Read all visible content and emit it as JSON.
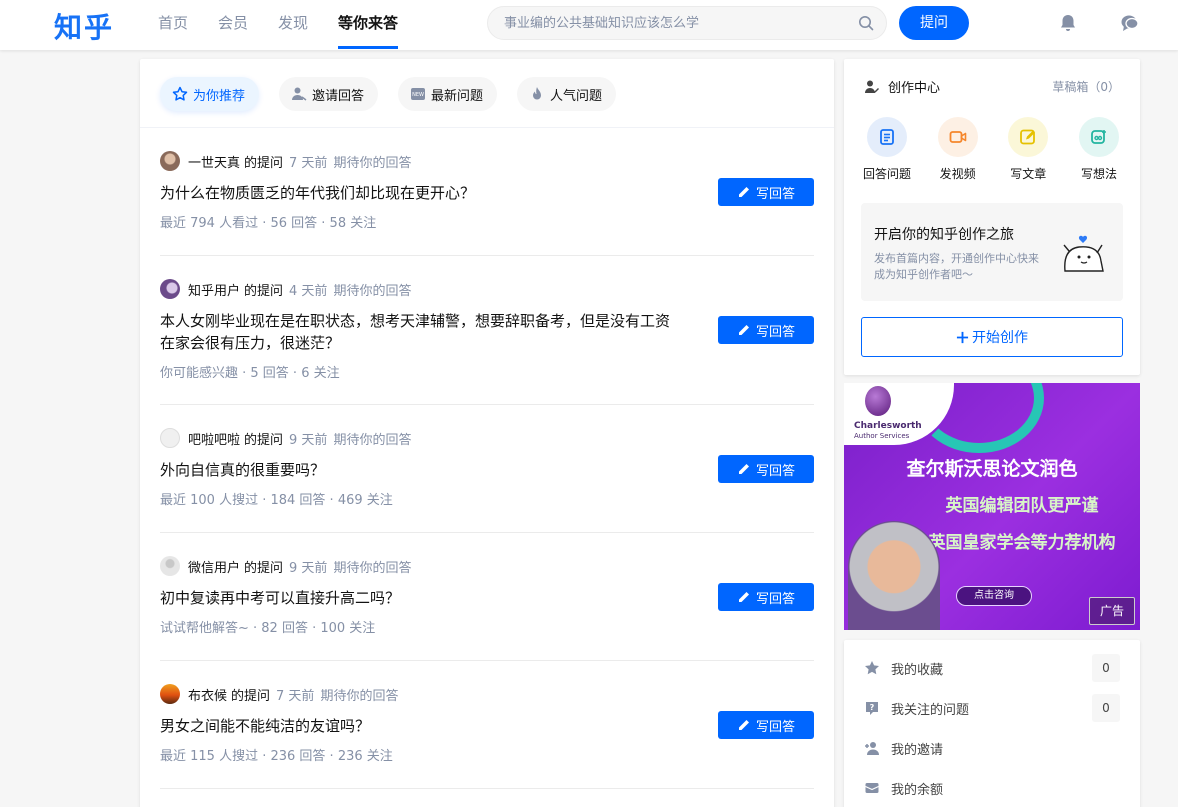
{
  "header": {
    "logo": "知乎",
    "nav": [
      "首页",
      "会员",
      "发现",
      "等你来答"
    ],
    "active_nav": "等你来答",
    "search_placeholder": "事业编的公共基础知识应该怎么学",
    "ask_label": "提问",
    "accent": "#0066ff"
  },
  "tabs": [
    {
      "label": "为你推荐",
      "icon": "star-icon"
    },
    {
      "label": "邀请回答",
      "icon": "invite-user-icon"
    },
    {
      "label": "最新问题",
      "icon": "new-badge-icon"
    },
    {
      "label": "人气问题",
      "icon": "flame-icon"
    }
  ],
  "questions": [
    {
      "author": "一世天真",
      "asked": "的提问",
      "time": "7 天前",
      "hint": "期待你的回答",
      "title": "为什么在物质匮乏的年代我们却比现在更开心？",
      "stats": "最近 794 人看过 · 56 回答 · 58 关注",
      "button": "写回答"
    },
    {
      "author": "知乎用户",
      "asked": "的提问",
      "time": "4 天前",
      "hint": "期待你的回答",
      "title": "本人女刚毕业现在是在职状态，想考天津辅警，想要辞职备考，但是没有工资在家会很有压力，很迷茫？",
      "stats": "你可能感兴趣 · 5 回答 · 6 关注",
      "button": "写回答"
    },
    {
      "author": "吧啦吧啦",
      "asked": "的提问",
      "time": "9 天前",
      "hint": "期待你的回答",
      "title": "外向自信真的很重要吗？",
      "stats": "最近 100 人搜过 · 184 回答 · 469 关注",
      "button": "写回答"
    },
    {
      "author": "微信用户",
      "asked": "的提问",
      "time": "9 天前",
      "hint": "期待你的回答",
      "title": "初中复读再中考可以直接升高二吗？",
      "stats": "试试帮他解答~ · 82 回答 · 100 关注",
      "button": "写回答"
    },
    {
      "author": "布衣候",
      "asked": "的提问",
      "time": "7 天前",
      "hint": "期待你的回答",
      "title": "男女之间能不能纯洁的友谊吗？",
      "stats": "最近 115 人搜过 · 236 回答 · 236 关注",
      "button": "写回答"
    }
  ],
  "creator": {
    "title": "创作中心",
    "drafts": "草稿箱（0）",
    "actions": [
      "回答问题",
      "发视频",
      "写文章",
      "写想法"
    ],
    "journey_title": "开启你的知乎创作之旅",
    "journey_desc": "发布首篇内容，开通创作中心快来成为知乎创作者吧～",
    "start_label": "开始创作"
  },
  "ad": {
    "brand": "Charlesworth",
    "brand_sub": "Author Services",
    "line1": "查尔斯沃思论文润色",
    "line2": "英国编辑团队更严谨",
    "line3": "英国皇家学会等力荐机构",
    "cta": "点击咨询",
    "tag": "广告"
  },
  "my": [
    {
      "label": "我的收藏",
      "count": "0",
      "icon": "star-icon"
    },
    {
      "label": "我关注的问题",
      "count": "0",
      "icon": "question-icon"
    },
    {
      "label": "我的邀请",
      "count": "",
      "icon": "add-user-icon"
    },
    {
      "label": "我的余额",
      "count": "",
      "icon": "wallet-icon"
    }
  ]
}
